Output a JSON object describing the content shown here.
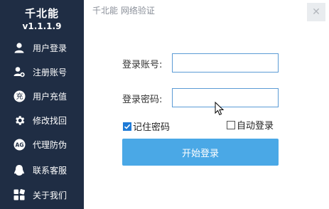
{
  "app": {
    "name": "千北能",
    "version": "v1.1.1.9",
    "window_title": "千北能 网络验证",
    "close_symbol": "✕"
  },
  "sidebar": {
    "items": [
      {
        "label": "用户登录",
        "icon": "user-icon"
      },
      {
        "label": "注册账号",
        "icon": "register-icon"
      },
      {
        "label": "用户充值",
        "icon": "recharge-icon",
        "icon_text": "充"
      },
      {
        "label": "修改找回",
        "icon": "gear-icon"
      },
      {
        "label": "代理防伪",
        "icon": "agent-icon",
        "icon_text": "AG"
      },
      {
        "label": "联系客服",
        "icon": "support-icon"
      },
      {
        "label": "关于我们",
        "icon": "about-icon"
      }
    ]
  },
  "form": {
    "account_label": "登录账号:",
    "account_value": "",
    "password_label": "登录密码:",
    "password_value": "",
    "remember_label": "记住密码",
    "remember_checked": true,
    "auto_login_label": "自动登录",
    "auto_login_checked": false,
    "submit_label": "开始登录"
  },
  "colors": {
    "sidebar_bg": "#1f2d44",
    "accent": "#4aa8e6",
    "input_border": "#5b9bd5",
    "checkbox": "#1e7ad6"
  }
}
